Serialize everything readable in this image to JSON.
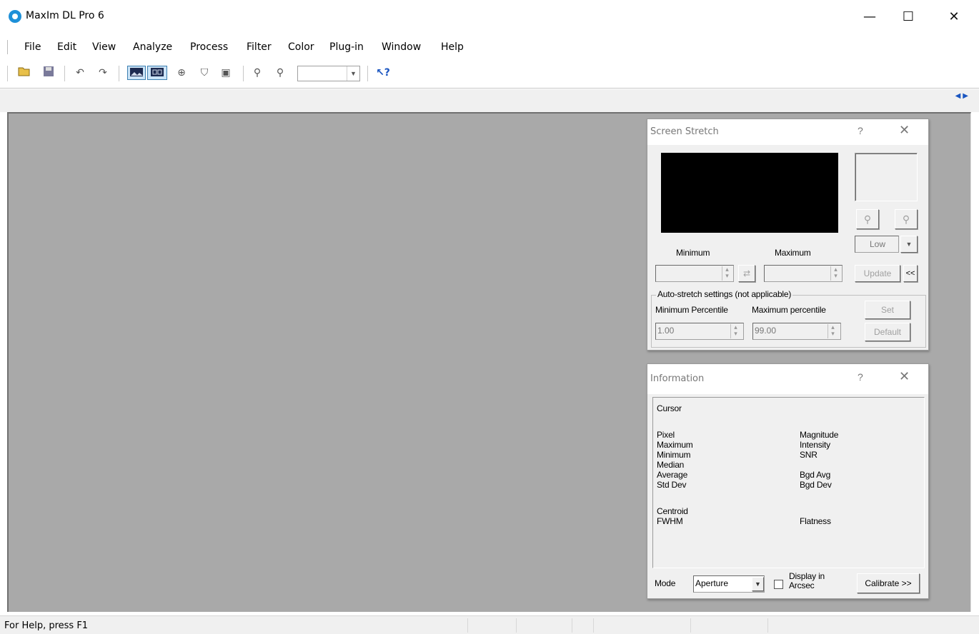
{
  "window": {
    "title": "MaxIm DL Pro 6",
    "minimize": "—",
    "maximize": "☐",
    "close": "✕"
  },
  "menu": [
    "File",
    "Edit",
    "View",
    "Analyze",
    "Process",
    "Filter",
    "Color",
    "Plug-in",
    "Window",
    "Help"
  ],
  "toolbar": {
    "zoom_combo_value": "",
    "help_icon": "↖?"
  },
  "status": {
    "text": "For Help, press F1"
  },
  "screen_stretch": {
    "title": "Screen Stretch",
    "help": "?",
    "close": "✕",
    "minimum_label": "Minimum",
    "maximum_label": "Maximum",
    "minimum_value": "",
    "maximum_value": "",
    "mode_value": "Low",
    "update_label": "Update",
    "collapse_label": "<<",
    "auto_group_label": "Auto-stretch settings (not applicable)",
    "min_percentile_label": "Minimum Percentile",
    "max_percentile_label": "Maximum percentile",
    "min_percentile_value": "1.00",
    "max_percentile_value": "99.00",
    "set_label": "Set",
    "default_label": "Default"
  },
  "information": {
    "title": "Information",
    "help": "?",
    "close": "✕",
    "cursor_label": "Cursor",
    "left_fields": [
      "Pixel",
      "Maximum",
      "Minimum",
      "Median",
      "Average",
      "Std Dev"
    ],
    "right_fields": [
      "Magnitude",
      "Intensity",
      "SNR",
      "",
      "Bgd Avg",
      "Bgd Dev"
    ],
    "centroid_label": "Centroid",
    "fwhm_label": "FWHM",
    "flatness_label": "Flatness",
    "mode_label": "Mode",
    "mode_value": "Aperture",
    "display_arcsec_line1": "Display in",
    "display_arcsec_line2": "Arcsec",
    "calibrate_label": "Calibrate >>"
  }
}
